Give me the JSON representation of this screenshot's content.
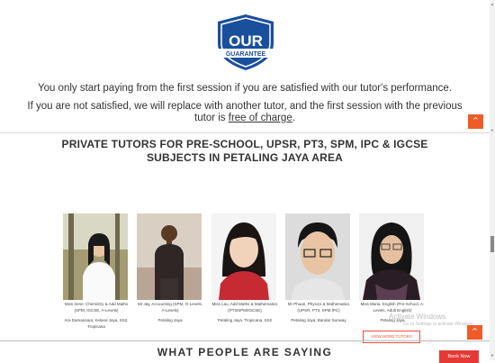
{
  "guarantee": {
    "badge_line1": "OUR",
    "badge_line2": "GUARANTEE",
    "line1": "You only start paying from the first session if you are satisfied with our tutor's performance.",
    "line2a": "If you are not satisfied, we will replace with another tutor, and the first session with the previous",
    "line2b": "tutor is ",
    "line2_link": "free of charge",
    "line2_end": "."
  },
  "tutors_section": {
    "heading_line1": "PRIVATE TUTORS FOR PRE-SCHOOL, UPSR, PT3, SPM, IPC & IGCSE",
    "heading_line2": "SUBJECTS IN PETALING JAYA AREA",
    "tutors": [
      {
        "name": "Miss Irene, Chemistry & Add Maths (SPM, IGCSE, A-Levels)",
        "location": "Ara Damansara, Kelana Jaya, SS2, Tropicana"
      },
      {
        "name": "Mr Jay, Accounting (SPM, O-Levels, A-Levels)",
        "location": "Petaling Jaya"
      },
      {
        "name": "Miss Lau, Add Maths & Mathematics (PT3/SPM/IGCSE)",
        "location": "Petaling Jaya, Tropicana, SS2"
      },
      {
        "name": "Mr Phuan, Physics & Mathematics (UPSR, PT3, SPM,IPC)",
        "location": "Petaling Jaya, Bandar Sunway"
      },
      {
        "name": "Miss Maria, English (Pre-School, A-Levels, Adult English)",
        "location": "Petaling Jaya"
      }
    ],
    "view_more": "VIEW MORE TUTORS"
  },
  "reviews": {
    "heading": "WHAT PEOPLE ARE SAYING"
  },
  "book_now": "Book Now",
  "windows_watermark": {
    "line1": "Activate Windows",
    "line2": "Go to Settings to activate Windows."
  },
  "colors": {
    "accent": "#f05a28",
    "brand_blue": "#1a4f9c",
    "book_now": "#e53935"
  },
  "icons": {
    "scroll_top": "chevron-up-icon"
  }
}
